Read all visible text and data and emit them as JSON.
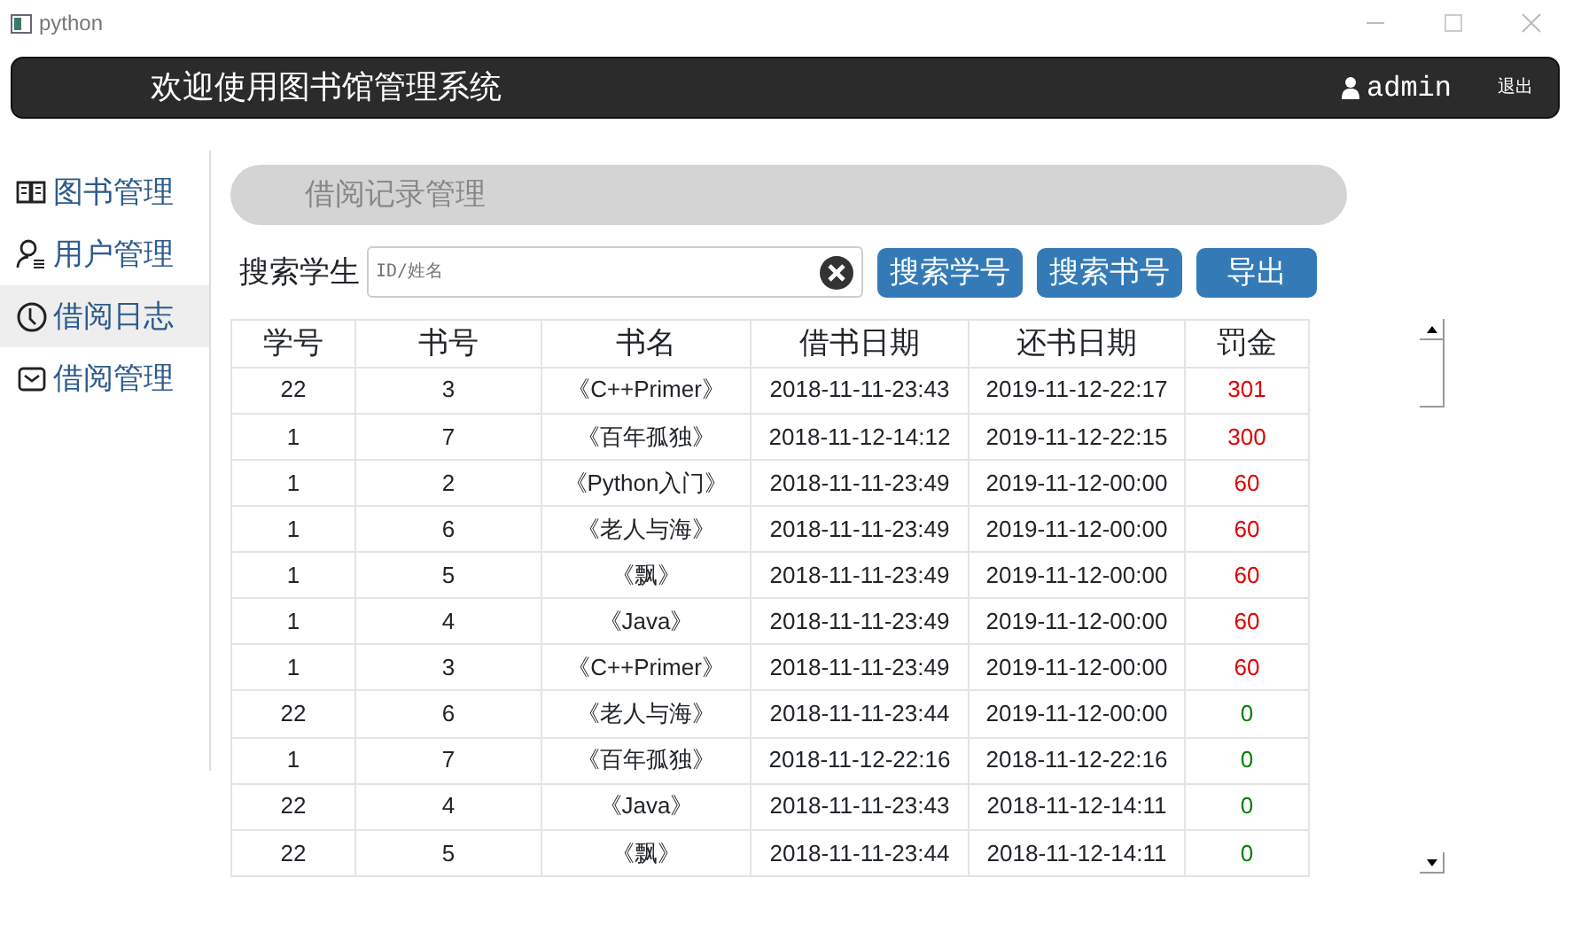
{
  "window": {
    "title": "python"
  },
  "header": {
    "title": "欢迎使用图书馆管理系统",
    "user": "admin",
    "logout": "退出"
  },
  "sidebar": {
    "items": [
      {
        "label": "图书管理",
        "selected": false
      },
      {
        "label": "用户管理",
        "selected": false
      },
      {
        "label": "借阅日志",
        "selected": true
      },
      {
        "label": "借阅管理",
        "selected": false
      }
    ]
  },
  "page_title": "借阅记录管理",
  "search": {
    "label": "搜索学生",
    "placeholder": "ID/姓名",
    "buttons": [
      "搜索学号",
      "搜索书号",
      "导出"
    ]
  },
  "table": {
    "columns": [
      "学号",
      "书号",
      "书名",
      "借书日期",
      "还书日期",
      "罚金"
    ],
    "rows": [
      {
        "cells": [
          "22",
          "3",
          "《C++Primer》",
          "2018-11-11-23:43",
          "2019-11-12-22:17",
          "301"
        ],
        "color": "#e00000"
      },
      {
        "cells": [
          "1",
          "7",
          "《百年孤独》",
          "2018-11-12-14:12",
          "2019-11-12-22:15",
          "300"
        ],
        "color": "#e00000"
      },
      {
        "cells": [
          "1",
          "2",
          "《Python入门》",
          "2018-11-11-23:49",
          "2019-11-12-00:00",
          "60"
        ],
        "color": "#e00000"
      },
      {
        "cells": [
          "1",
          "6",
          "《老人与海》",
          "2018-11-11-23:49",
          "2019-11-12-00:00",
          "60"
        ],
        "color": "#e00000"
      },
      {
        "cells": [
          "1",
          "5",
          "《飘》",
          "2018-11-11-23:49",
          "2019-11-12-00:00",
          "60"
        ],
        "color": "#e00000"
      },
      {
        "cells": [
          "1",
          "4",
          "《Java》",
          "2018-11-11-23:49",
          "2019-11-12-00:00",
          "60"
        ],
        "color": "#e00000"
      },
      {
        "cells": [
          "1",
          "3",
          "《C++Primer》",
          "2018-11-11-23:49",
          "2019-11-12-00:00",
          "60"
        ],
        "color": "#e00000"
      },
      {
        "cells": [
          "22",
          "6",
          "《老人与海》",
          "2018-11-11-23:44",
          "2019-11-12-00:00",
          "0"
        ],
        "color": "#008000"
      },
      {
        "cells": [
          "1",
          "7",
          "《百年孤独》",
          "2018-11-12-22:16",
          "2018-11-12-22:16",
          "0"
        ],
        "color": "#008000"
      },
      {
        "cells": [
          "22",
          "4",
          "《Java》",
          "2018-11-11-23:43",
          "2018-11-12-14:11",
          "0"
        ],
        "color": "#008000"
      },
      {
        "cells": [
          "22",
          "5",
          "《飘》",
          "2018-11-11-23:44",
          "2018-11-12-14:11",
          "0"
        ],
        "color": "#008000"
      }
    ]
  }
}
